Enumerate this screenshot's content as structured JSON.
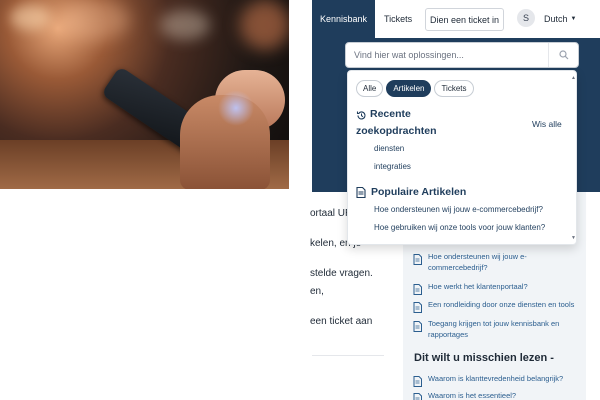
{
  "header": {
    "nav_kennisbank": "Kennisbank",
    "nav_tickets": "Tickets",
    "submit_ticket": "Dien een ticket in",
    "avatar_initial": "S",
    "language": "Dutch"
  },
  "search": {
    "placeholder": "Vind hier wat oplossingen...",
    "value": "",
    "icon": "search-icon"
  },
  "dropdown": {
    "filters": [
      "Alle",
      "Artikelen",
      "Tickets"
    ],
    "active_filter": "Artikelen",
    "recent": {
      "title_line1": "Recente",
      "title_line2": "zoekopdrachten",
      "icon": "history-icon",
      "clear_all": "Wis alle",
      "items": [
        "diensten",
        "integraties"
      ]
    },
    "popular": {
      "title": "Populaire Artikelen",
      "icon": "document-icon",
      "items": [
        "Hoe ondersteunen wij jouw e-commercebedrijf?",
        "Hoe gebruiken wij onze tools voor jouw klanten?"
      ]
    }
  },
  "body_fragments": [
    "ortaal UR",
    "kelen, en je",
    "stelde vragen.",
    "en,",
    "een ticket aan"
  ],
  "side": {
    "links": [
      "Hoe ondersteunen wij jouw e-commercebedrijf?",
      "Hoe werkt het klantenportaal?",
      "Een rondleiding door onze diensten en tools",
      "Toegang krijgen tot jouw kennisbank en rapportages"
    ],
    "heading": "Dit wilt u misschien lezen -",
    "more_links": [
      "Waarom is klanttevredenheid belangrijk?",
      "Waarom is het essentieel?"
    ]
  },
  "colors": {
    "brand_navy": "#1f3d5c",
    "link_blue": "#2b5e8f",
    "side_panel": "#f1f4f7"
  }
}
